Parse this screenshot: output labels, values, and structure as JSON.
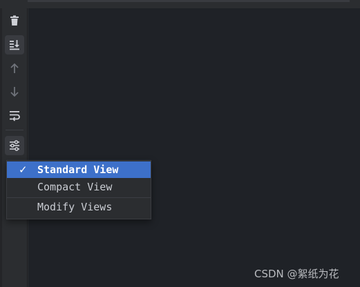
{
  "toolbar": {
    "buttons": [
      {
        "icon": "trash-icon",
        "label": "Clear"
      },
      {
        "icon": "scroll-to-end-icon",
        "label": "Scroll to end"
      },
      {
        "icon": "arrow-up-icon",
        "label": "Up"
      },
      {
        "icon": "arrow-down-icon",
        "label": "Down"
      },
      {
        "icon": "soft-wrap-icon",
        "label": "Soft wrap"
      },
      {
        "icon": "settings-sliders-icon",
        "label": "View settings"
      }
    ]
  },
  "view_menu": {
    "check_mark": "✓",
    "items": [
      {
        "label": "Standard View",
        "selected": true
      },
      {
        "label": "Compact View",
        "selected": false
      },
      {
        "label": "Modify Views",
        "selected": false
      }
    ]
  },
  "watermark": "CSDN @絮纸为花",
  "colors": {
    "background": "#2b2d30",
    "content": "#1f2227",
    "selection": "#3d70c9",
    "icon": "#ced0d6",
    "icon_disabled": "#6f737a"
  }
}
